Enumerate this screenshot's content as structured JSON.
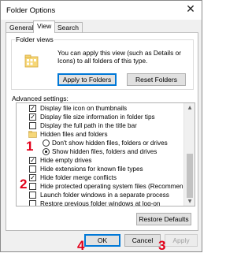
{
  "window": {
    "title": "Folder Options",
    "close_glyph": "✕"
  },
  "tabs": [
    {
      "label": "General",
      "active": false
    },
    {
      "label": "View",
      "active": true
    },
    {
      "label": "Search",
      "active": false
    }
  ],
  "folder_views": {
    "legend": "Folder views",
    "description": "You can apply this view (such as Details or Icons) to all folders of this type.",
    "apply_button": "Apply to Folders",
    "reset_button": "Reset Folders"
  },
  "advanced": {
    "label": "Advanced settings:",
    "items": [
      {
        "kind": "checkbox",
        "checked": true,
        "label": "Display file icon on thumbnails"
      },
      {
        "kind": "checkbox",
        "checked": true,
        "label": "Display file size information in folder tips"
      },
      {
        "kind": "checkbox",
        "checked": false,
        "label": "Display the full path in the title bar"
      },
      {
        "kind": "folder",
        "label": "Hidden files and folders"
      },
      {
        "kind": "radio",
        "checked": false,
        "label": "Don't show hidden files, folders or drives"
      },
      {
        "kind": "radio",
        "checked": true,
        "label": "Show hidden files, folders and drives"
      },
      {
        "kind": "checkbox",
        "checked": true,
        "label": "Hide empty drives"
      },
      {
        "kind": "checkbox",
        "checked": false,
        "label": "Hide extensions for known file types"
      },
      {
        "kind": "checkbox",
        "checked": true,
        "label": "Hide folder merge conflicts"
      },
      {
        "kind": "checkbox",
        "checked": false,
        "label": "Hide protected operating system files (Recommended)"
      },
      {
        "kind": "checkbox",
        "checked": false,
        "label": "Launch folder windows in a separate process"
      },
      {
        "kind": "checkbox",
        "checked": false,
        "label": "Restore previous folder windows at log-on"
      }
    ],
    "restore_button": "Restore Defaults"
  },
  "footer": {
    "ok_button": "OK",
    "cancel_button": "Cancel",
    "apply_button": "Apply"
  },
  "annotations": {
    "a1": "1",
    "a2": "2",
    "a3": "3",
    "a4": "4",
    "color": "#e2001a"
  },
  "icons": {
    "folder": "folder-options-icon",
    "check": "✓"
  }
}
